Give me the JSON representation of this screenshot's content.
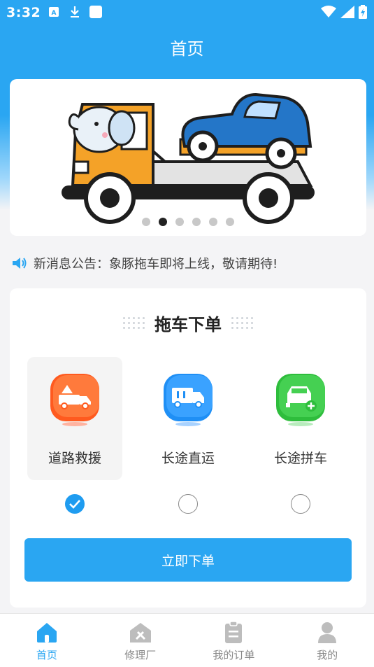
{
  "status_bar": {
    "time": "3:32"
  },
  "header": {
    "title": "首页"
  },
  "banner": {
    "dot_count": 6,
    "active_index": 1
  },
  "notice": {
    "text": "新消息公告：象豚拖车即将上线，敬请期待!"
  },
  "order_card": {
    "title": "拖车下单",
    "services": [
      {
        "label": "道路救援",
        "icon": "rescue-truck-icon",
        "color": "#ff5a1f",
        "selected": true
      },
      {
        "label": "长途直运",
        "icon": "long-haul-truck-icon",
        "color": "#1f8ff5",
        "selected": false
      },
      {
        "label": "长途拼车",
        "icon": "carpool-car-icon",
        "color": "#2ebd3c",
        "selected": false
      }
    ],
    "submit_label": "立即下单"
  },
  "tabbar": {
    "items": [
      {
        "label": "首页",
        "icon": "home-icon",
        "active": true
      },
      {
        "label": "修理厂",
        "icon": "repair-shop-icon",
        "active": false
      },
      {
        "label": "我的订单",
        "icon": "orders-icon",
        "active": false
      },
      {
        "label": "我的",
        "icon": "profile-icon",
        "active": false
      }
    ]
  },
  "colors": {
    "accent": "#2aa6f2",
    "active_dot": "#222222",
    "inactive_dot": "#c8c8c8"
  }
}
